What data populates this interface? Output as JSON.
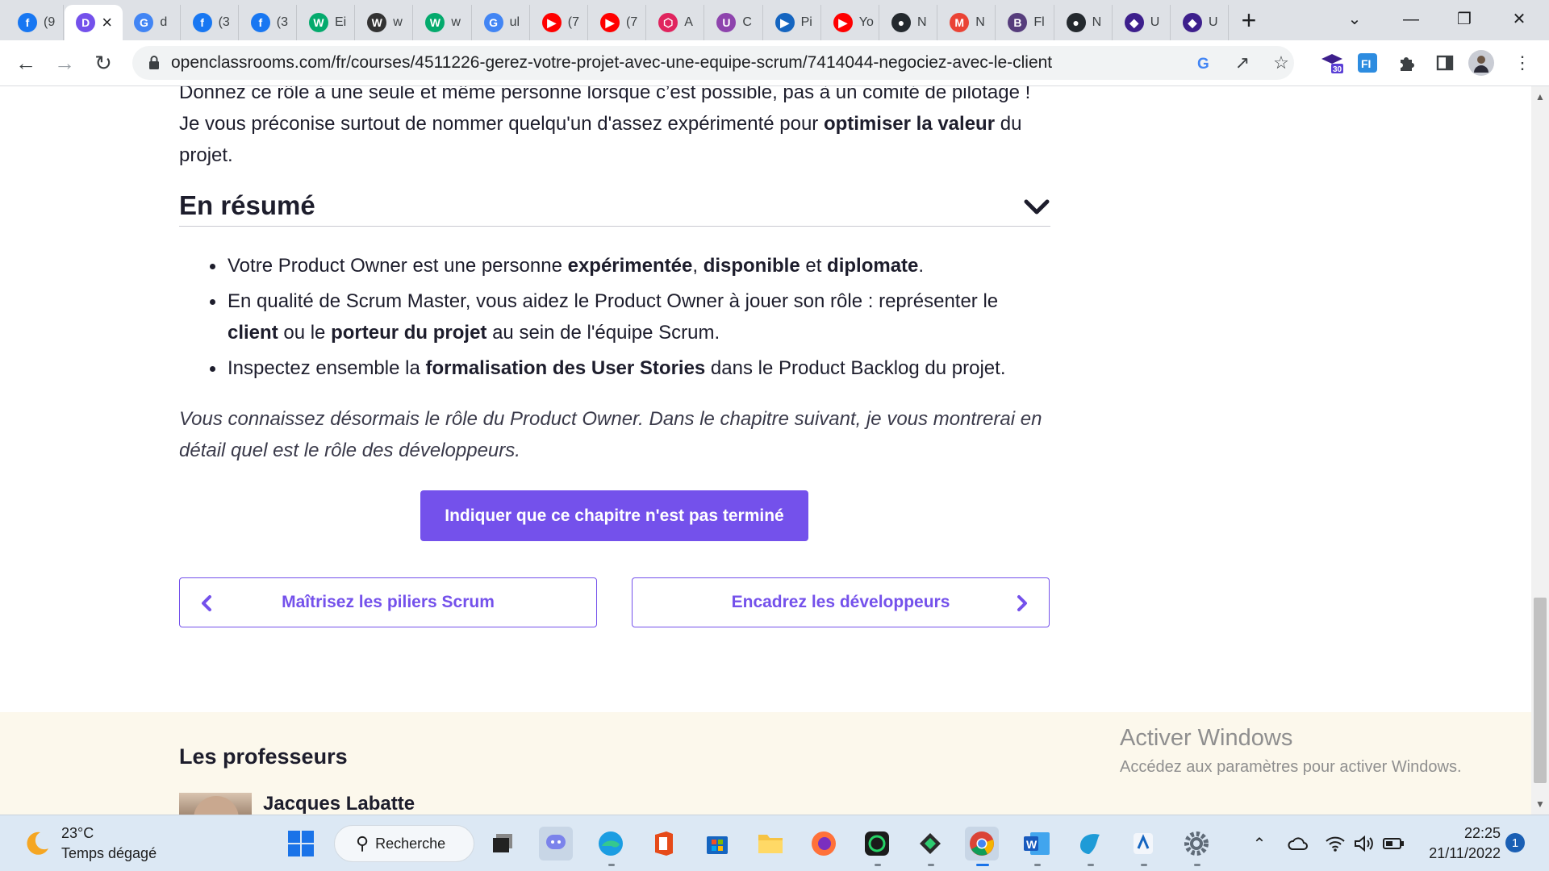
{
  "browser": {
    "tabs": [
      {
        "favicon": "facebook-icon",
        "color": "#1877f2",
        "glyph": "f",
        "title": "(9"
      },
      {
        "favicon": "openclassrooms-icon",
        "color": "#7451eb",
        "glyph": "D",
        "title": "",
        "active": true
      },
      {
        "favicon": "google-icon",
        "color": "#4285f4",
        "glyph": "G",
        "title": "d"
      },
      {
        "favicon": "facebook-icon",
        "color": "#1877f2",
        "glyph": "f",
        "title": "(3"
      },
      {
        "favicon": "facebook-icon",
        "color": "#1877f2",
        "glyph": "f",
        "title": "(3"
      },
      {
        "favicon": "w3-icon",
        "color": "#04aa6d",
        "glyph": "W",
        "title": "Ei"
      },
      {
        "favicon": "w3-icon",
        "color": "#333333",
        "glyph": "W",
        "title": "w"
      },
      {
        "favicon": "w3-icon",
        "color": "#04aa6d",
        "glyph": "W",
        "title": "w"
      },
      {
        "favicon": "google-icon",
        "color": "#4285f4",
        "glyph": "G",
        "title": "ul"
      },
      {
        "favicon": "youtube-icon",
        "color": "#ff0000",
        "glyph": "▶",
        "title": "(7"
      },
      {
        "favicon": "youtube-icon",
        "color": "#ff0000",
        "glyph": "▶",
        "title": "(7"
      },
      {
        "favicon": "hexagon-icon",
        "color": "#e0245e",
        "glyph": "⬡",
        "title": "A"
      },
      {
        "favicon": "u-badge-icon",
        "color": "#8e44ad",
        "glyph": "U",
        "title": "C"
      },
      {
        "favicon": "play-circle-icon",
        "color": "#1565c0",
        "glyph": "▶",
        "title": "Pi"
      },
      {
        "favicon": "youtube-icon",
        "color": "#ff0000",
        "glyph": "▶",
        "title": "Yo"
      },
      {
        "favicon": "github-icon",
        "color": "#24292e",
        "glyph": "●",
        "title": "N"
      },
      {
        "favicon": "gmail-icon",
        "color": "#ea4335",
        "glyph": "M",
        "title": "N"
      },
      {
        "favicon": "bootstrap-icon",
        "color": "#563d7c",
        "glyph": "B",
        "title": "Fl"
      },
      {
        "favicon": "github-icon",
        "color": "#24292e",
        "glyph": "●",
        "title": "N"
      },
      {
        "favicon": "diamond-icon",
        "color": "#3d1f8c",
        "glyph": "◆",
        "title": "U"
      },
      {
        "favicon": "diamond-icon",
        "color": "#3d1f8c",
        "glyph": "◆",
        "title": "U"
      }
    ],
    "new_tab_glyph": "+",
    "url": "openclassrooms.com/fr/courses/4511226-gerez-votre-projet-avec-une-equipe-scrum/7414044-negociez-avec-le-client",
    "extension_badge": "30"
  },
  "article": {
    "intro_part1": "Donnez ce rôle à une seule et même personne lorsque c’est possible, pas à un comité de pilotage ! Je vous préconise surtout de nommer quelqu'un d'assez expérimenté pour ",
    "intro_bold": "optimiser la valeur",
    "intro_part2": " du projet.",
    "summary_heading": "En résumé",
    "bullet1": {
      "p1": "Votre Product Owner est une personne ",
      "b1": "expérimentée",
      "p2": ", ",
      "b2": "disponible",
      "p3": " et ",
      "b3": "diplomate",
      "p4": "."
    },
    "bullet2": {
      "p1": "En qualité de Scrum Master, vous aidez le Product Owner à jouer son rôle : représenter le ",
      "b1": "client",
      "p2": " ou le ",
      "b2": "porteur du projet",
      "p3": " au sein de l'équipe Scrum."
    },
    "bullet3": {
      "p1": "Inspectez ensemble la ",
      "b1": "formalisation des User Stories",
      "p2": " dans le Product Backlog du projet."
    },
    "closing": "Vous connaissez désormais le rôle du Product Owner. Dans le chapitre suivant, je vous montrerai en détail quel est le rôle des développeurs.",
    "complete_button": "Indiquer que ce chapitre n'est pas terminé",
    "prev_chapter": "Maîtrisez les piliers Scrum",
    "next_chapter": "Encadrez les développeurs"
  },
  "professors": {
    "title": "Les professeurs",
    "name": "Jacques Labatte"
  },
  "watermark": {
    "title": "Activer Windows",
    "subtitle": "Accédez aux paramètres pour activer Windows."
  },
  "taskbar": {
    "weather_temp": "23°C",
    "weather_desc": "Temps dégagé",
    "search_label": "Recherche",
    "time": "22:25",
    "date": "21/11/2022",
    "notifications": "1"
  },
  "colors": {
    "accent": "#7451eb",
    "text": "#1d1d2c",
    "footer_bg": "#fcf8ec"
  }
}
